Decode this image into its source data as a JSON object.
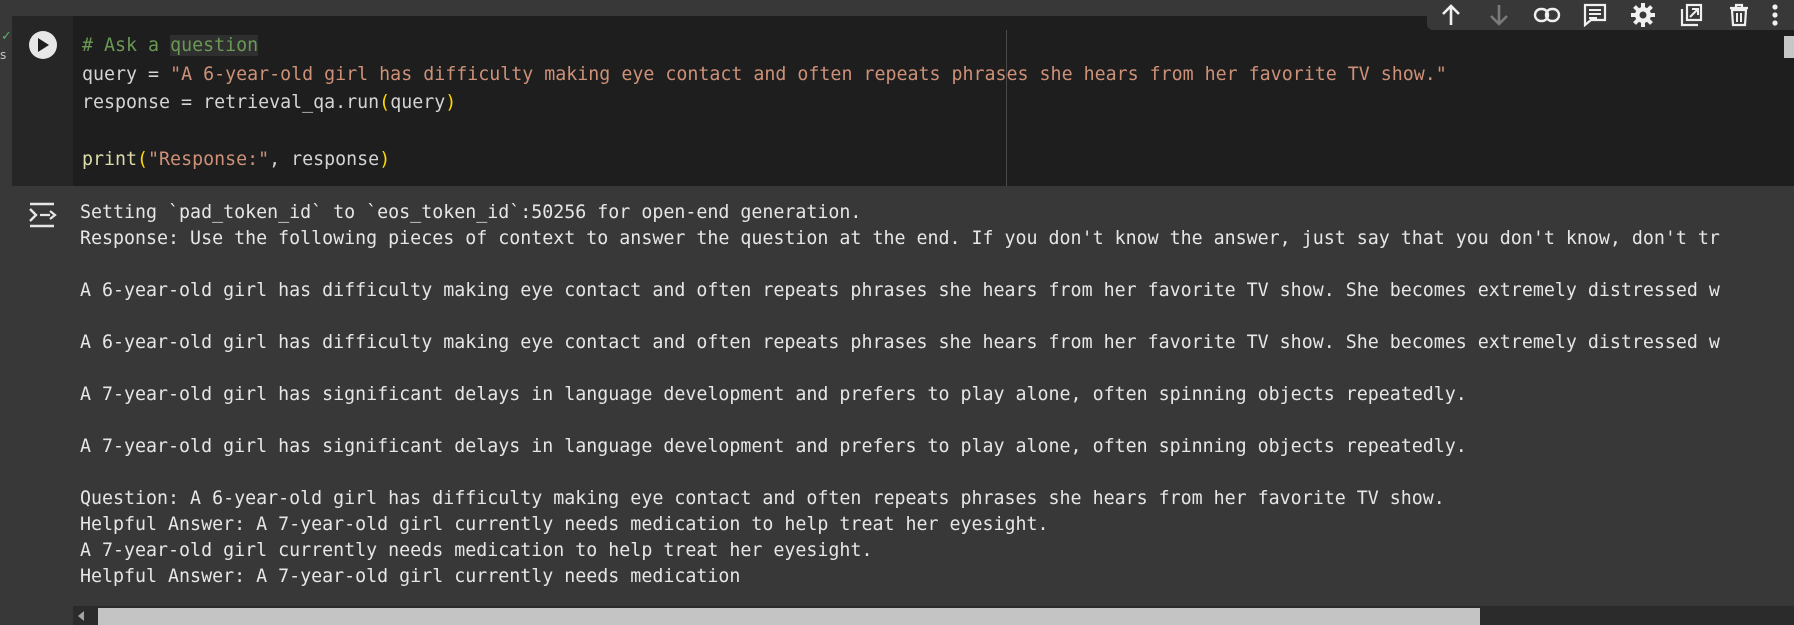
{
  "gutter": {
    "status_mark": "✓",
    "exec_time_fragment": "s"
  },
  "toolbar": {
    "icons": [
      "arrow-up-icon",
      "arrow-down-icon",
      "link-icon",
      "comment-icon",
      "settings-icon",
      "mirror-cell-icon",
      "delete-icon",
      "more-vert-icon"
    ]
  },
  "cell": {
    "code": {
      "comment_hash": "# Ask a ",
      "comment_word": "question",
      "query_prefix": "query = ",
      "query_string": "\"A 6-year-old girl has difficulty making eye contact and often repeats phrases she hears from her favorite TV show.\"",
      "response_prefix": "response = retrieval_qa.run",
      "response_paren_open": "(",
      "response_arg": "query",
      "response_paren_close": ")",
      "print_fn": "print",
      "print_paren_open": "(",
      "print_string": "\"Response:\"",
      "print_rest": ", response",
      "print_paren_close": ")"
    },
    "output_lines": [
      "Setting `pad_token_id` to `eos_token_id`:50256 for open-end generation.",
      "Response: Use the following pieces of context to answer the question at the end. If you don't know the answer, just say that you don't know, don't tr",
      "",
      "A 6-year-old girl has difficulty making eye contact and often repeats phrases she hears from her favorite TV show. She becomes extremely distressed w",
      "",
      "A 6-year-old girl has difficulty making eye contact and often repeats phrases she hears from her favorite TV show. She becomes extremely distressed w",
      "",
      "A 7-year-old girl has significant delays in language development and prefers to play alone, often spinning objects repeatedly.",
      "",
      "A 7-year-old girl has significant delays in language development and prefers to play alone, often spinning objects repeatedly.",
      "",
      "Question: A 6-year-old girl has difficulty making eye contact and often repeats phrases she hears from her favorite TV show.",
      "Helpful Answer: A 7-year-old girl currently needs medication to help treat her eyesight.",
      "A 7-year-old girl currently needs medication to help treat her eyesight.",
      "Helpful Answer: A 7-year-old girl currently needs medication"
    ]
  },
  "colors": {
    "code_bg": "#1e1e1e",
    "output_bg": "#383838",
    "comment": "#6a9955",
    "string": "#ce9178",
    "paren": "#ffd700"
  }
}
